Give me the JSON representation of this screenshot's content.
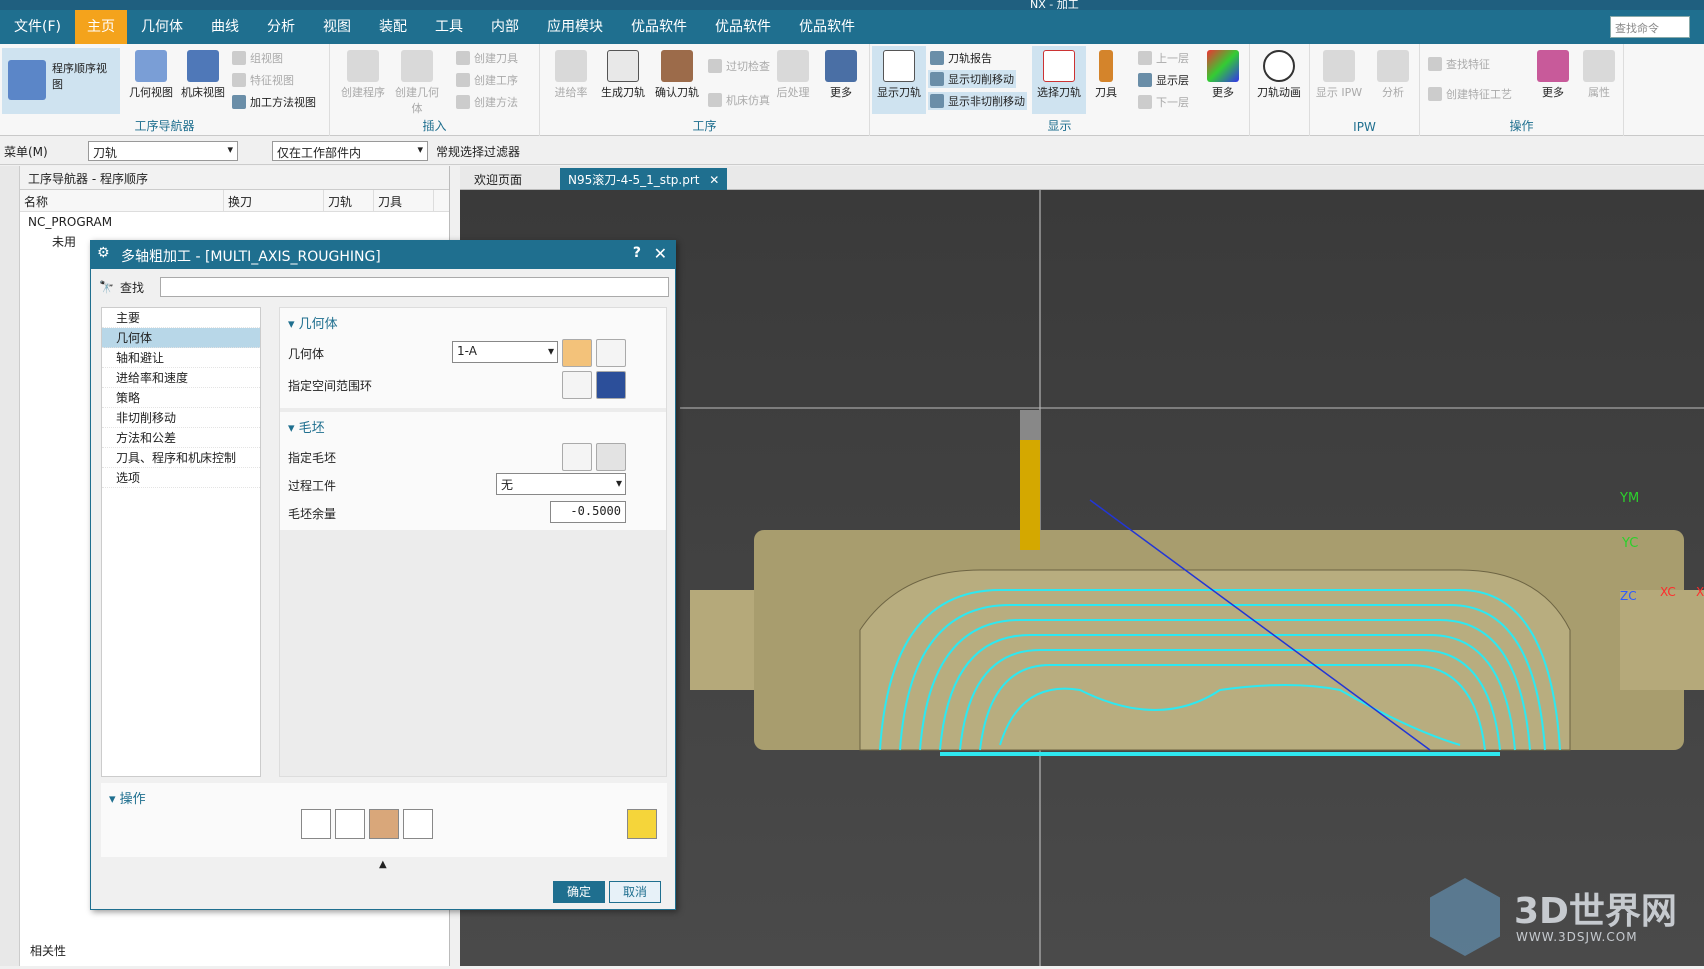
{
  "window": {
    "title": "NX - 加工"
  },
  "menubar": {
    "file": "文件(F)",
    "tabs": [
      "主页",
      "几何体",
      "曲线",
      "分析",
      "视图",
      "装配",
      "工具",
      "内部",
      "应用模块",
      "优品软件",
      "优品软件",
      "优品软件"
    ],
    "search_placeholder": "查找命令"
  },
  "ribbon": {
    "navigator_group": {
      "label": "工序导航器",
      "program_order_view": "程序顺序视图",
      "geometry_view": "几何视图",
      "machine_view": "机床视图",
      "group_view": "组视图",
      "feature_view": "特征视图",
      "method_view": "加工方法视图"
    },
    "insert_group": {
      "label": "插入",
      "create_program": "创建程序",
      "create_geometry": "创建几何体",
      "create_tool": "创建刀具",
      "create_operation": "创建工序",
      "create_method": "创建方法"
    },
    "operation_group": {
      "label": "工序",
      "feed_rate": "进给率",
      "generate_toolpath": "生成刀轨",
      "verify_toolpath": "确认刀轨",
      "collision_check": "过切检查",
      "machine_sim": "机床仿真",
      "postprocess": "后处理",
      "more": "更多"
    },
    "display_group": {
      "label": "显示",
      "show_toolpath": "显示刀轨",
      "toolpath_report": "刀轨报告",
      "show_cut_moves": "显示切削移动",
      "show_noncut_moves": "显示非切削移动",
      "select_toolpath": "选择刀轨",
      "tool": "刀具",
      "prev_layer": "上一层",
      "show_layer": "显示层",
      "next_layer": "下一层",
      "more": "更多",
      "toolpath_animation": "刀轨动画"
    },
    "ipw_group": {
      "label": "IPW",
      "show_ipw": "显示 IPW",
      "analysis": "分析"
    },
    "ops_group": {
      "label": "操作",
      "find_feature": "查找特征",
      "create_feature_process": "创建特征工艺",
      "more": "更多",
      "properties": "属性"
    }
  },
  "toolbar2": {
    "menu": "菜单(M)",
    "type_filter": "刀轨",
    "scope_filter": "仅在工作部件内",
    "select_filter": "常规选择过滤器"
  },
  "navigator": {
    "title": "工序导航器 - 程序顺序",
    "columns": [
      "名称",
      "换刀",
      "刀轨",
      "刀具"
    ],
    "root": "NC_PROGRAM",
    "unused": "未用",
    "footer": "相关性"
  },
  "doc_tabs": {
    "welcome": "欢迎页面",
    "part": "N95滚刀-4-5_1_stp.prt"
  },
  "dialog": {
    "title": "多轴粗加工 - [MULTI_AXIS_ROUGHING]",
    "search_label": "查找",
    "categories": [
      "主要",
      "几何体",
      "轴和避让",
      "进给率和速度",
      "策略",
      "非切削移动",
      "方法和公差",
      "刀具、程序和机床控制",
      "选项"
    ],
    "geometry_section": {
      "title": "几何体",
      "geometry_label": "几何体",
      "geometry_value": "1-A",
      "space_range_label": "指定空间范围环"
    },
    "blank_section": {
      "title": "毛坯",
      "specify_blank": "指定毛坯",
      "process_workpiece": "过程工件",
      "process_workpiece_value": "无",
      "blank_stock": "毛坯余量",
      "blank_stock_value": "-0.5000"
    },
    "operations_title": "操作",
    "ok": "确定",
    "cancel": "取消"
  },
  "viewport": {
    "axes": {
      "ym": "YM",
      "yc": "YC",
      "zc": "ZC",
      "xc": "XC",
      "x": "X"
    }
  },
  "watermark": {
    "brand": "3D世界网",
    "url": "WWW.3DSJW.COM"
  },
  "colors": {
    "accent": "#1f6f8f",
    "active_tab": "#f4a31c",
    "toolpath": "#2ee8f0",
    "part": "#a89d6e"
  }
}
